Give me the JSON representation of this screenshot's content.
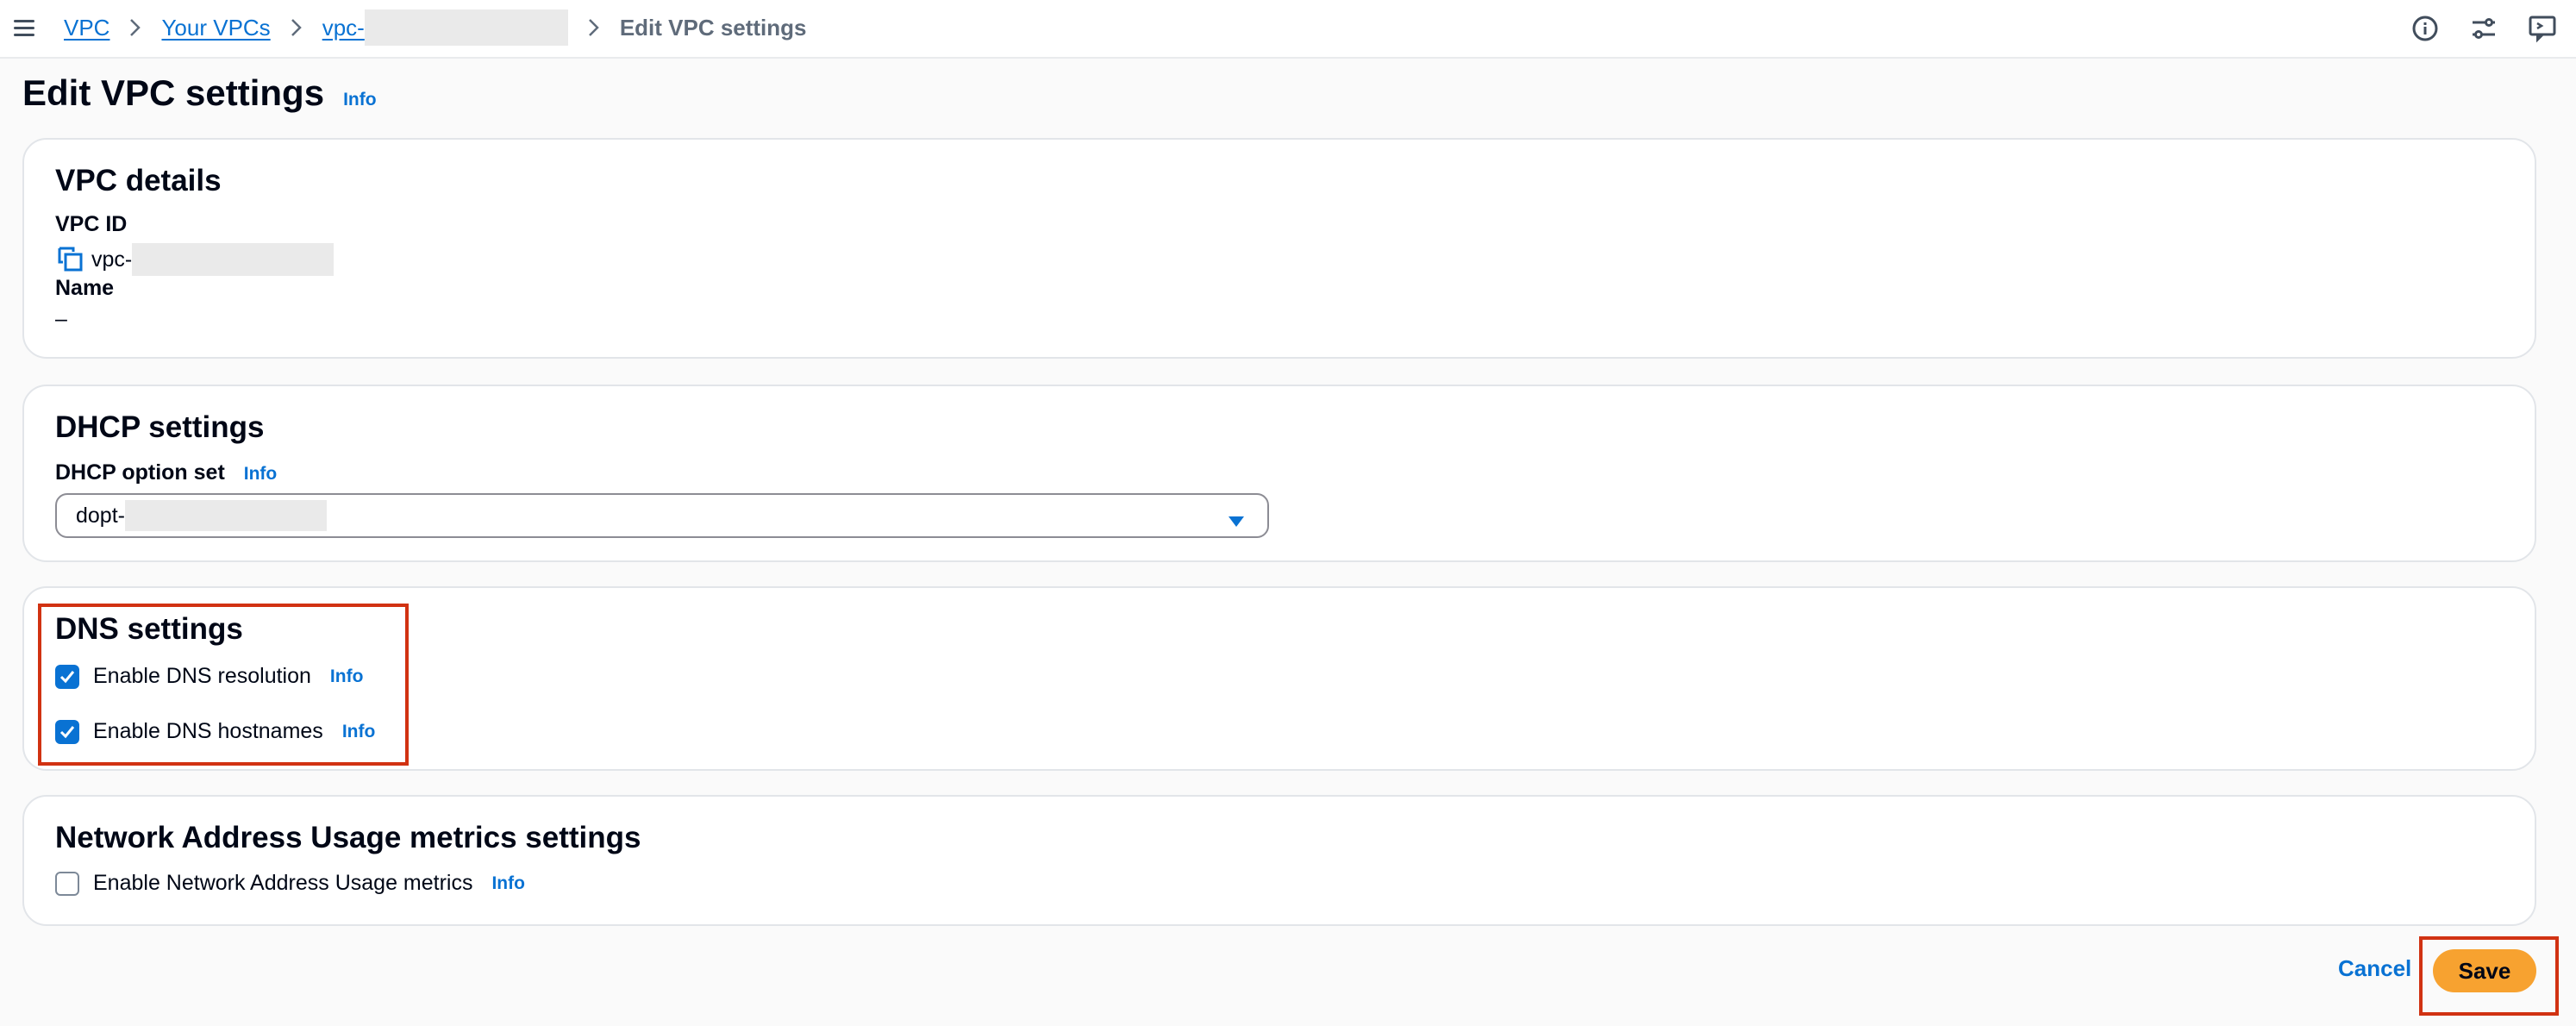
{
  "breadcrumb": {
    "items": [
      "VPC",
      "Your VPCs",
      "vpc-"
    ],
    "current": "Edit VPC settings"
  },
  "page": {
    "title": "Edit VPC settings",
    "info": "Info"
  },
  "vpc_details": {
    "heading": "VPC details",
    "vpc_id_label": "VPC ID",
    "vpc_id_value": "vpc-",
    "name_label": "Name",
    "name_value": "–"
  },
  "dhcp": {
    "heading": "DHCP settings",
    "option_set_label": "DHCP option set",
    "info": "Info",
    "selected": "dopt-"
  },
  "dns": {
    "heading": "DNS settings",
    "resolution_label": "Enable DNS resolution",
    "resolution_checked": true,
    "hostnames_label": "Enable DNS hostnames",
    "hostnames_checked": true,
    "info": "Info"
  },
  "nau": {
    "heading": "Network Address Usage metrics settings",
    "metrics_label": "Enable Network Address Usage metrics",
    "metrics_checked": false,
    "info": "Info"
  },
  "actions": {
    "cancel": "Cancel",
    "save": "Save"
  },
  "colors": {
    "link": "#0972d3",
    "primary_button": "#f7a230",
    "highlight": "#d13212"
  }
}
